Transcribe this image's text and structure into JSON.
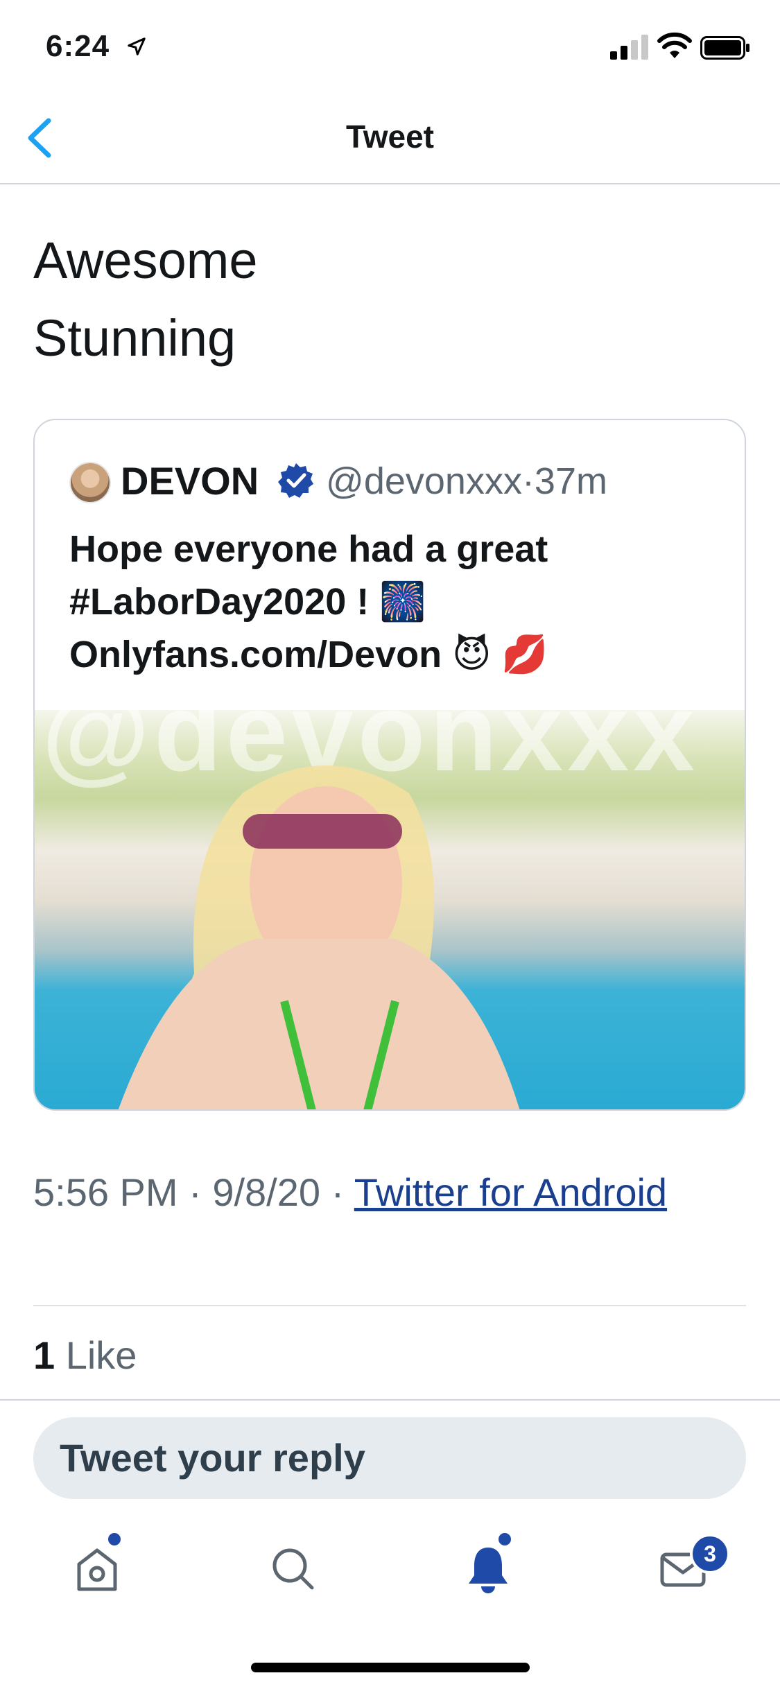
{
  "status_bar": {
    "time": "6:24"
  },
  "nav": {
    "title": "Tweet"
  },
  "tweet": {
    "text": "Awesome\nStunning"
  },
  "quote": {
    "name": "DEVON",
    "handle_time": "@devonxxx·37m",
    "body": "Hope everyone had a great #LaborDay2020 ! 🎆 Onlyfans.com/Devon 😈 💋",
    "media_watermark": "@devonxxx"
  },
  "meta": {
    "time_date": "5:56 PM · 9/8/20 · ",
    "source_link": "Twitter for Android"
  },
  "likes": {
    "count": "1",
    "label": " Like"
  },
  "reply": {
    "placeholder": "Tweet your reply"
  },
  "tabbar": {
    "messages_badge": "3"
  },
  "colors": {
    "accent": "#1da1f2",
    "link": "#1b3f8f",
    "active_tab": "#1f4aa8"
  }
}
